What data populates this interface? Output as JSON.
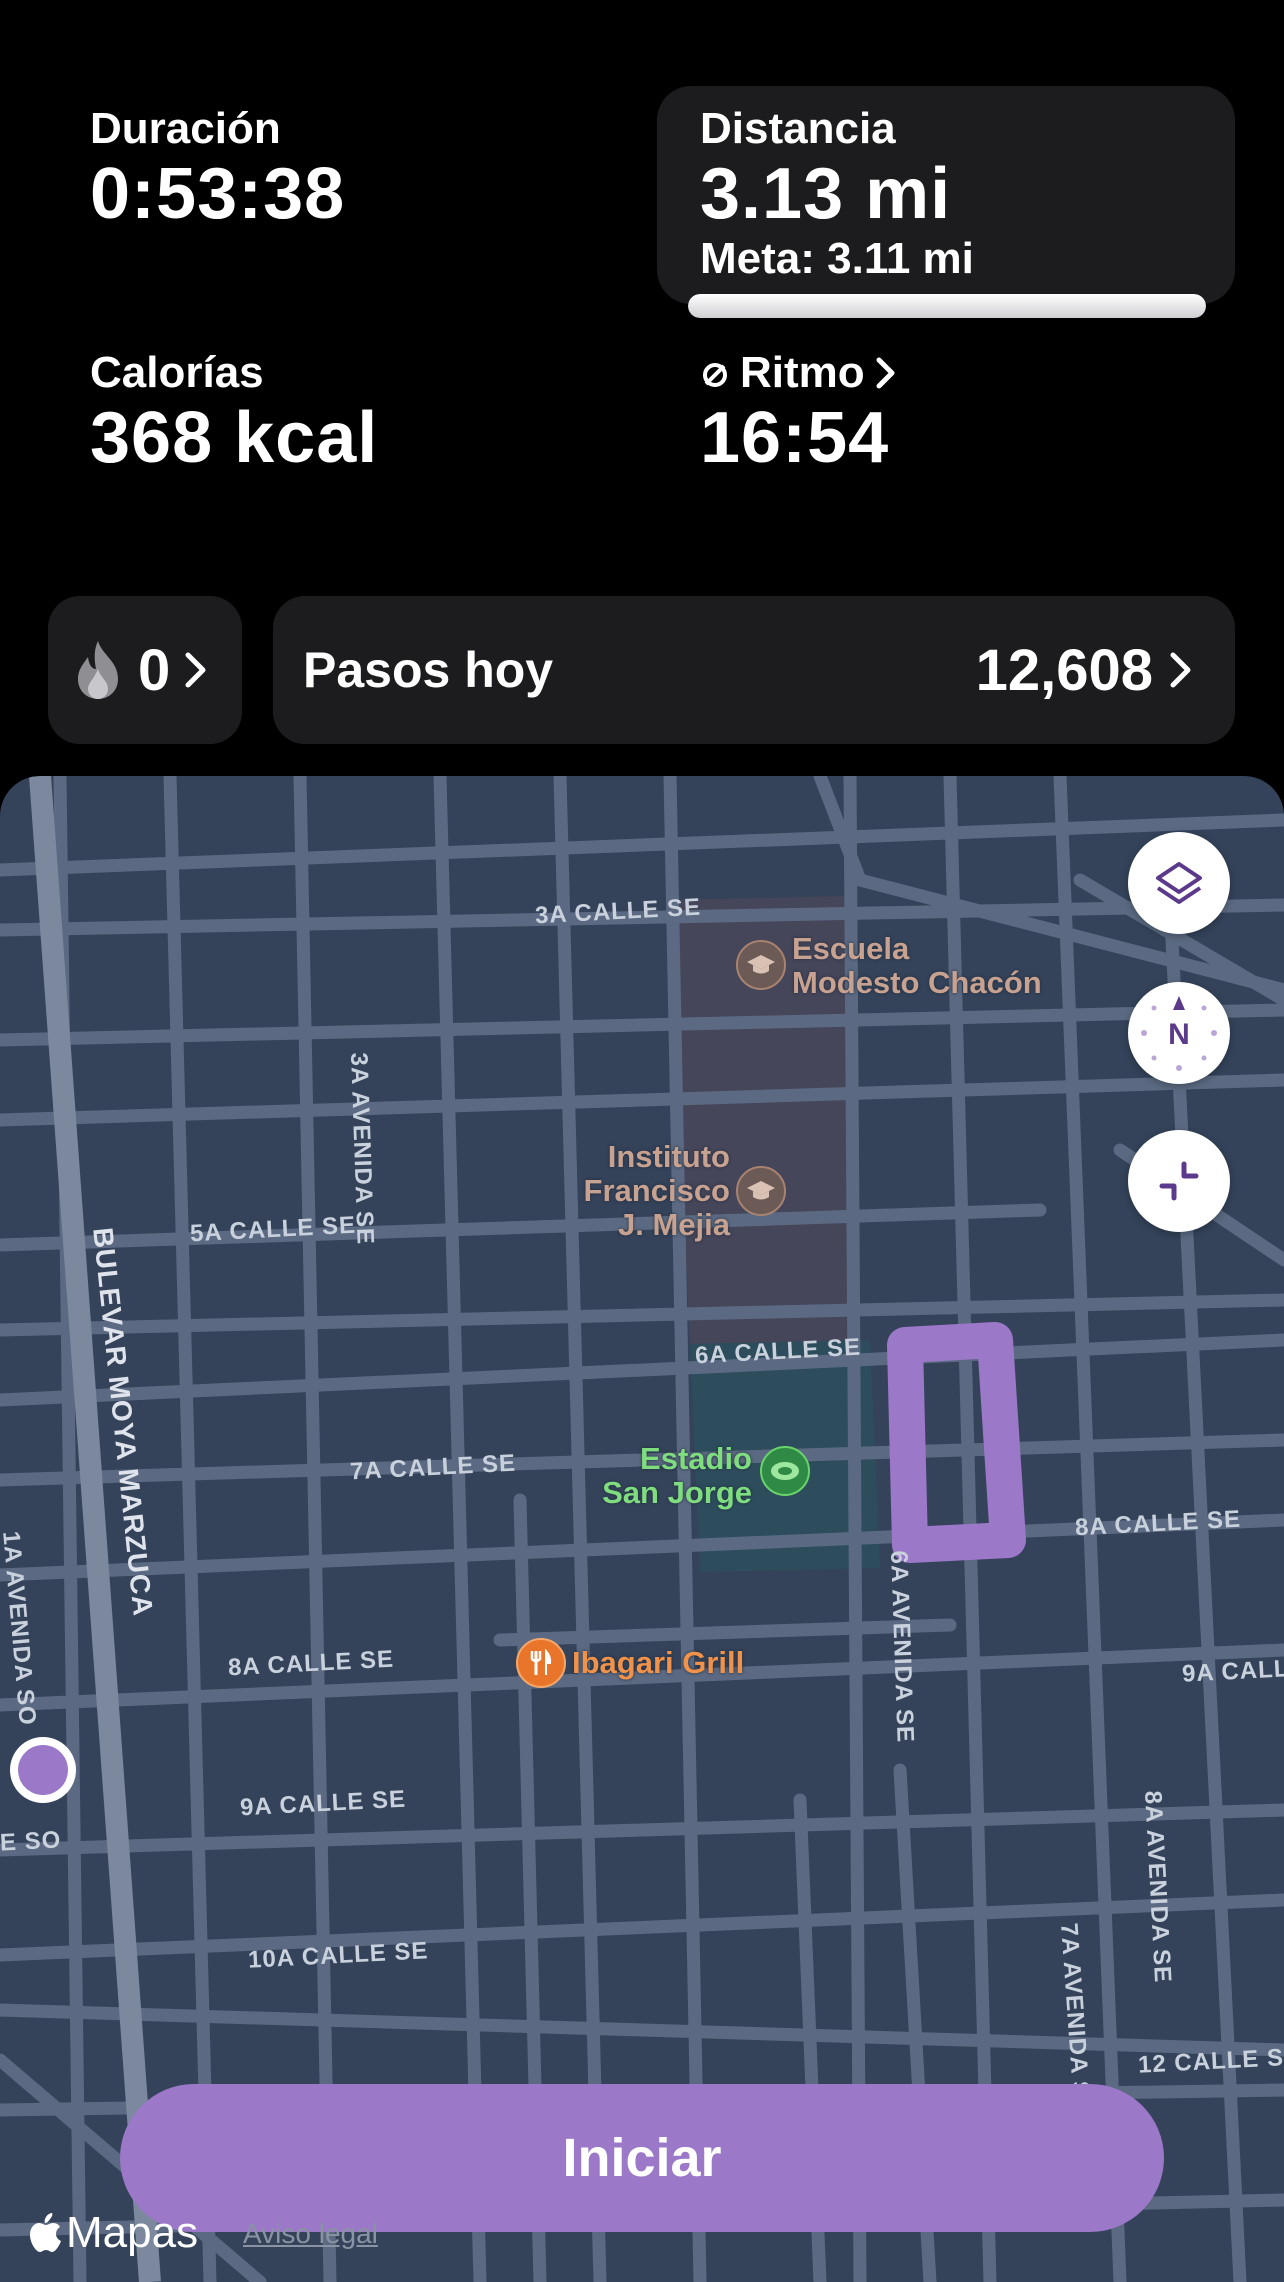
{
  "colors": {
    "accent": "#9b78c8",
    "card_bg": "#1c1c1e",
    "map_bg": "#34435a",
    "poi_brown": "#a88370",
    "poi_green": "#6bd36b",
    "poi_orange": "#f08b3a"
  },
  "stats": {
    "duration": {
      "label": "Duración",
      "value": "0:53:38"
    },
    "distance": {
      "label": "Distancia",
      "value": "3.13 mi",
      "goal": "Meta: 3.11 mi",
      "goal_progress": 1.0
    },
    "calories": {
      "label": "Calorías",
      "value": "368 kcal"
    },
    "pace": {
      "label": "Ritmo",
      "value": "16:54",
      "icon": "average-pace-icon"
    }
  },
  "streak": {
    "value": "0",
    "icon": "flame-icon"
  },
  "steps": {
    "label": "Pasos hoy",
    "value": "12,608"
  },
  "map": {
    "streets": {
      "calle_3a": "3A CALLE SE",
      "calle_5a": "5A CALLE SE",
      "calle_6a": "6A CALLE SE",
      "calle_7a": "7A CALLE SE",
      "calle_8a_w": "8A CALLE SE",
      "calle_8a_e": "8A CALLE SE",
      "calle_9a_e": "9A CALL",
      "calle_9a_w": "9A CALLE SE",
      "calle_10a": "10A CALLE SE",
      "calle_12a": "12 CALLE S",
      "avenida_3a": "3A AVENIDA SE",
      "avenida_6a": "6A AVENIDA SE",
      "avenida_7a": "7A AVENIDA S",
      "avenida_8a": "8A AVENIDA SE",
      "avenida_1a": "1A AVENIDA SO",
      "bulevar": "BULEVAR MOYA MARZUCA",
      "calle_so": "E SO"
    },
    "pois": {
      "escuela": [
        "Escuela",
        "Modesto Chacón"
      ],
      "instituto": [
        "Instituto",
        "Francisco",
        "J. Mejia"
      ],
      "estadio": [
        "Estadio",
        "San Jorge"
      ],
      "grill": "Ibagari Grill"
    },
    "buttons": {
      "layers": "layers-icon",
      "compass": "N",
      "collapse": "collapse-icon"
    }
  },
  "start_button": "Iniciar",
  "footer": {
    "maps_brand": "Mapas",
    "legal": "Aviso legal"
  }
}
